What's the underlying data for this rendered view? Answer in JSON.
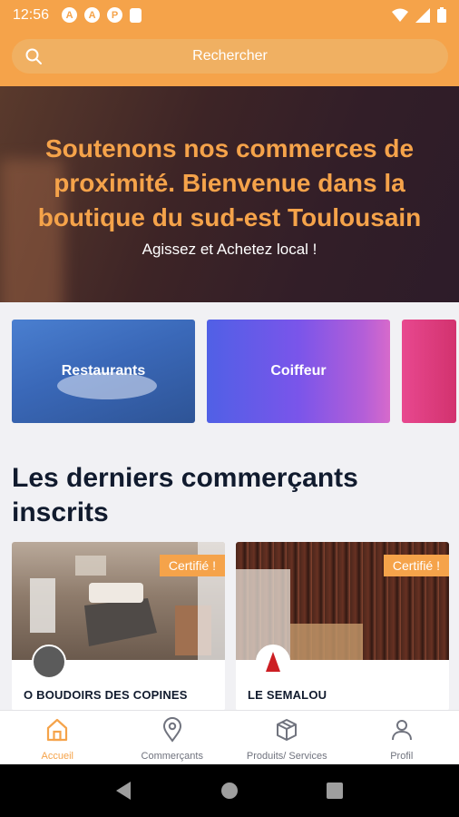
{
  "status_bar": {
    "time": "12:56",
    "left_icons": [
      "A",
      "A",
      "P",
      "sd"
    ]
  },
  "search": {
    "placeholder": "Rechercher"
  },
  "hero": {
    "title": "Soutenons nos commerces de proximité. Bienvenue dans la boutique du sud-est Toulousain",
    "subtitle": "Agissez et Achetez local !"
  },
  "categories": [
    {
      "label": "Restaurants"
    },
    {
      "label": "Coiffeur"
    },
    {
      "label": ""
    }
  ],
  "section": {
    "title": "Les derniers commerçants inscrits"
  },
  "merchants": [
    {
      "name": "O BOUDOIRS DES COPINES",
      "badge": "Certifié !"
    },
    {
      "name": "LE SEMALOU",
      "badge": "Certifié !"
    }
  ],
  "bottom_nav": [
    {
      "label": "Accueil",
      "icon": "home-icon",
      "active": true
    },
    {
      "label": "Commerçants",
      "icon": "location-pin-icon",
      "active": false
    },
    {
      "label": "Produits/ Services",
      "icon": "package-icon",
      "active": false
    },
    {
      "label": "Profil",
      "icon": "user-icon",
      "active": false
    }
  ],
  "colors": {
    "accent": "#f5a34a",
    "text_dark": "#111b2e",
    "nav_inactive": "#70737e"
  }
}
